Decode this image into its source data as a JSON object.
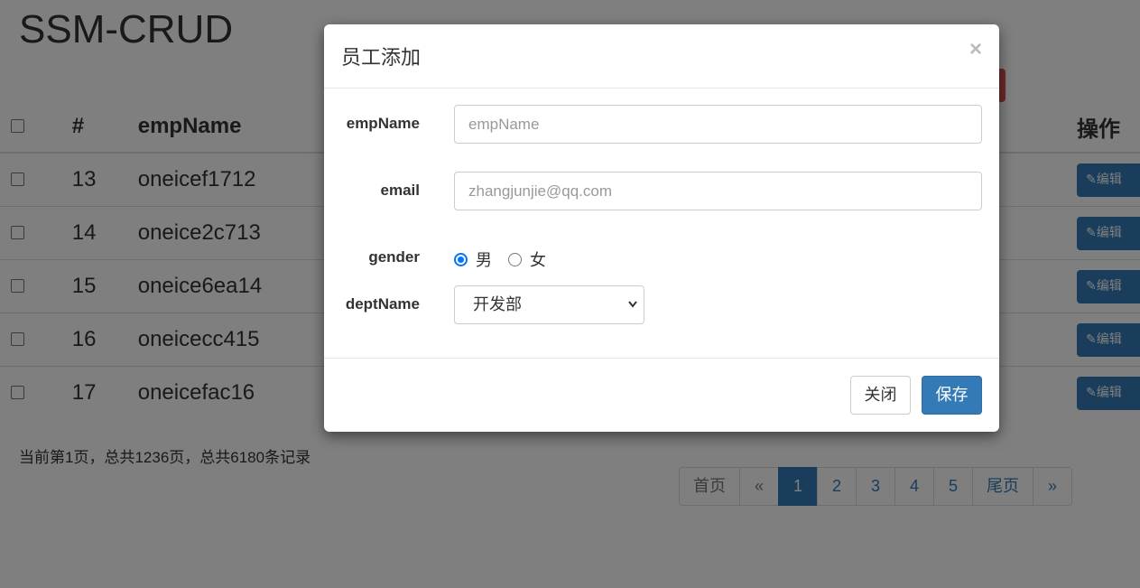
{
  "app": {
    "title": "SSM-CRUD"
  },
  "table": {
    "headers": {
      "id": "#",
      "name": "empName",
      "ops": "操作"
    },
    "rows": [
      {
        "id": "13",
        "name": "oneicef1712"
      },
      {
        "id": "14",
        "name": "oneice2c713"
      },
      {
        "id": "15",
        "name": "oneice6ea14"
      },
      {
        "id": "16",
        "name": "oneicecc415"
      },
      {
        "id": "17",
        "name": "oneicefac16"
      }
    ],
    "edit_label": "✎编辑"
  },
  "pagination": {
    "info": "当前第1页，总共1236页，总共6180条记录",
    "first": "首页",
    "prev": "«",
    "pages": [
      "1",
      "2",
      "3",
      "4",
      "5"
    ],
    "active_page": "1",
    "last": "尾页",
    "next": "»"
  },
  "modal": {
    "title": "员工添加",
    "close_symbol": "×",
    "empname": {
      "label": "empName",
      "placeholder": "empName"
    },
    "email": {
      "label": "email",
      "placeholder": "zhangjunjie@qq.com"
    },
    "gender": {
      "label": "gender",
      "options": [
        "男",
        "女"
      ],
      "selected": "男"
    },
    "dept": {
      "label": "deptName",
      "selected": "开发部"
    },
    "buttons": {
      "close": "关闭",
      "save": "保存"
    }
  },
  "colors": {
    "primary": "#337ab7",
    "danger": "#d9534f",
    "radio": "#0075ff"
  }
}
